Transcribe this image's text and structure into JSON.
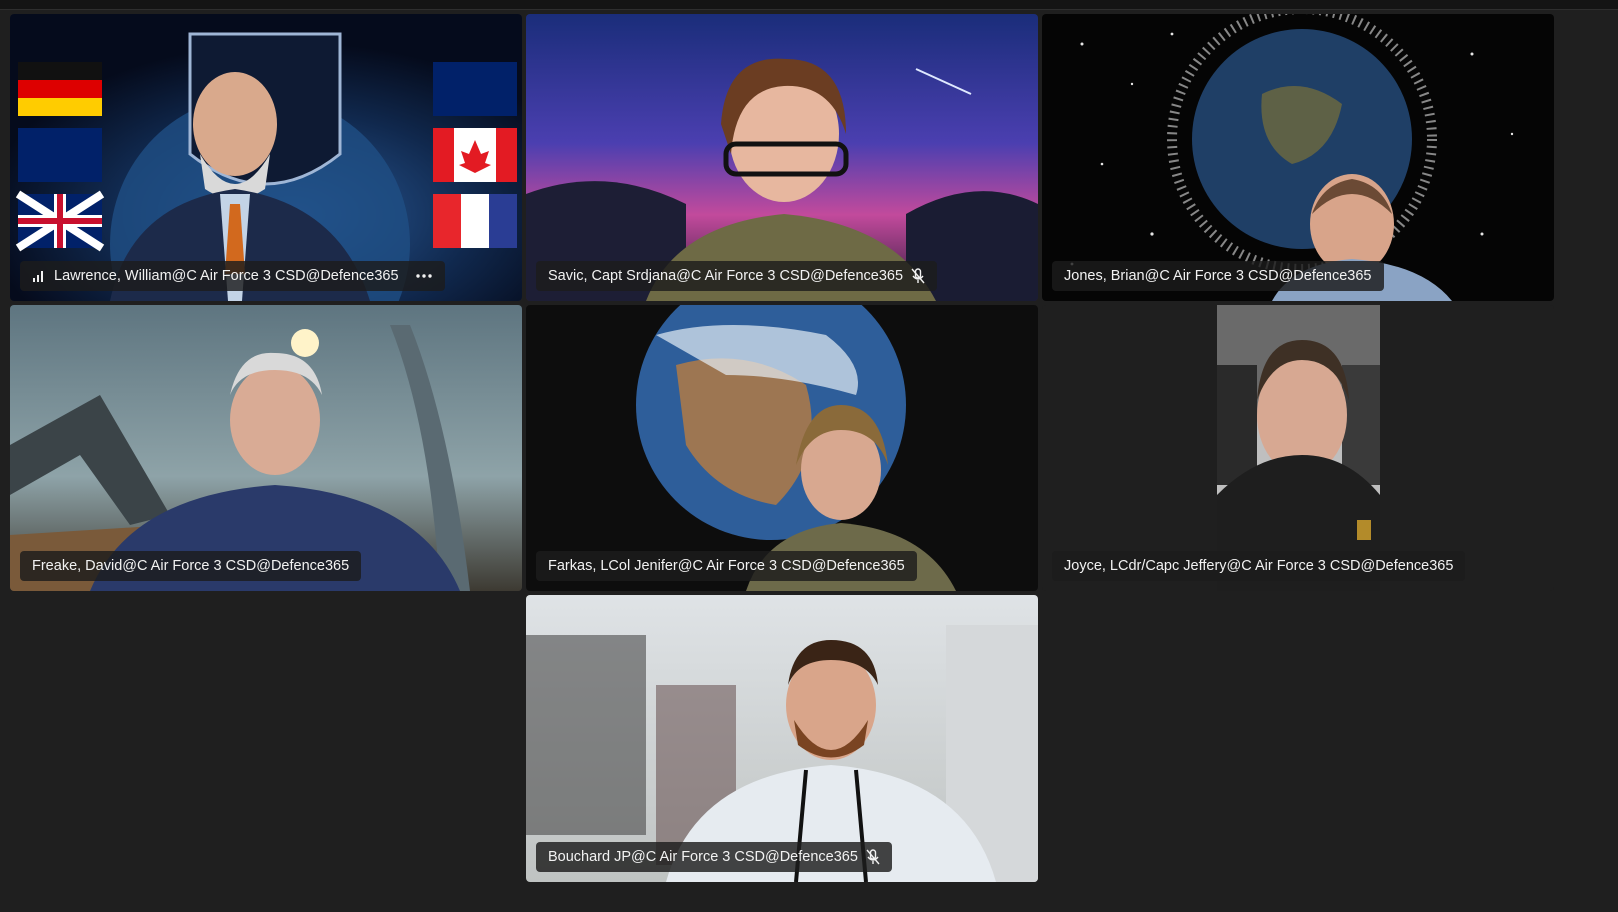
{
  "participants": [
    {
      "name": "Lawrence, William@C Air Force 3 CSD@Defence365",
      "icons": [
        "signal-bars-icon",
        "more-options-icon"
      ]
    },
    {
      "name": "Savic, Capt Srdjana@C Air Force 3 CSD@Defence365",
      "icons": [
        "mic-muted-icon"
      ]
    },
    {
      "name": "Jones, Brian@C Air Force 3 CSD@Defence365",
      "icons": []
    },
    {
      "name": "Freake, David@C Air Force 3 CSD@Defence365",
      "icons": []
    },
    {
      "name": "Farkas, LCol Jenifer@C Air Force 3 CSD@Defence365",
      "icons": []
    },
    {
      "name": "Joyce, LCdr/Capc Jeffery@C Air Force 3 CSD@Defence365",
      "icons": []
    },
    {
      "name": "Bouchard JP@C Air Force 3 CSD@Defence365",
      "icons": [
        "mic-muted-icon"
      ]
    }
  ],
  "colors": {
    "background": "#1f1f1f",
    "label_bg": "#1c1c1c",
    "label_text": "#f2f2f2"
  }
}
